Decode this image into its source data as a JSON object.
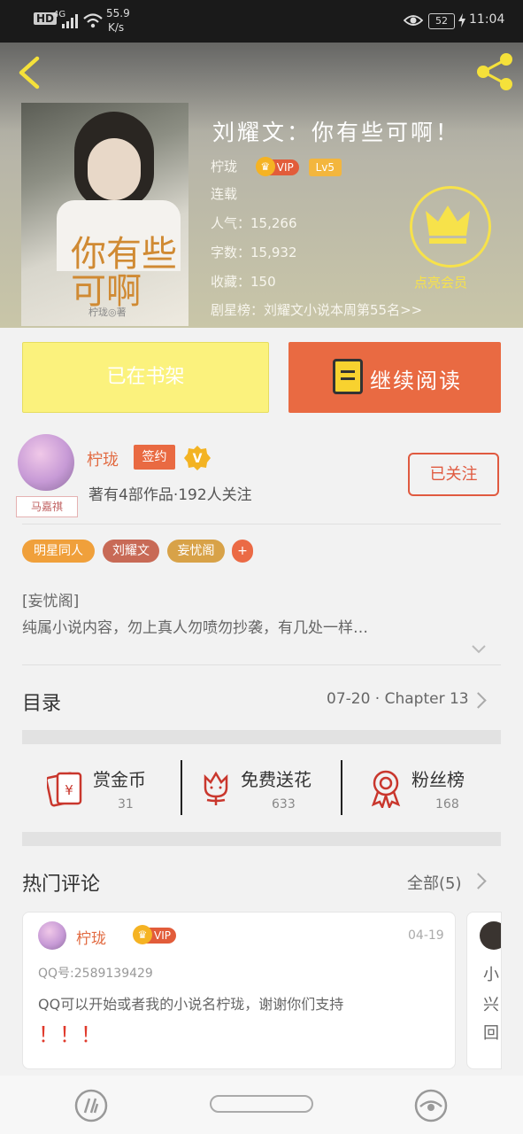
{
  "status_bar": {
    "hd": "HD",
    "net": "4G",
    "speed": "55.9",
    "speed_unit": "K/s",
    "battery": "52",
    "time": "11:04"
  },
  "book": {
    "title": "刘耀文：你有些可啊！",
    "author": "柠珑",
    "vip": "VIP",
    "level": "Lv5",
    "status": "连载",
    "popularity": "人气：15,266",
    "word_count": "字数：15,932",
    "favorites": "收藏：150",
    "ranking": "剧星榜：刘耀文小说本周第55名>>",
    "member_label": "点亮会员",
    "cover_title": "你有些可啊",
    "cover_author": "柠珑◎著"
  },
  "actions": {
    "shelf": "已在书架",
    "read": "继续阅读"
  },
  "author": {
    "name": "柠珑",
    "signed": "签约",
    "v": "V",
    "subtitle": "著有4部作品·192人关注",
    "follow": "已关注",
    "avatar_tag": "马嘉祺"
  },
  "tags": [
    {
      "label": "明星同人",
      "color": "#f0a03b"
    },
    {
      "label": "刘耀文",
      "color": "#c86a56"
    },
    {
      "label": "妄忧阁",
      "color": "#d8a248"
    },
    {
      "label": "+",
      "color": "#eb6a45"
    }
  ],
  "intro": {
    "line1": "[妄忧阁]",
    "line2": "纯属小说内容，勿上真人勿喷勿抄袭，有几处一样…"
  },
  "catalog": {
    "title": "目录",
    "latest": "07-20 · Chapter 13"
  },
  "stats": [
    {
      "label": "赏金币",
      "value": "31",
      "icon": "red-envelope-icon"
    },
    {
      "label": "免费送花",
      "value": "633",
      "icon": "flower-icon"
    },
    {
      "label": "粉丝榜",
      "value": "168",
      "icon": "medal-icon"
    }
  ],
  "comments": {
    "title": "热门评论",
    "all": "全部(5)",
    "items": [
      {
        "user": "柠珑",
        "vip": "VIP",
        "date": "04-19",
        "line1": "QQ号:2589139429",
        "line2": "QQ可以开始或者我的小说名柠珑，谢谢你们支持",
        "line3": "！！！"
      }
    ],
    "peek": [
      "小",
      "兴",
      "回"
    ]
  },
  "colors": {
    "accent": "#e96a42",
    "shelf_bg": "#fbf27d",
    "member_gold": "#f7e24a"
  }
}
